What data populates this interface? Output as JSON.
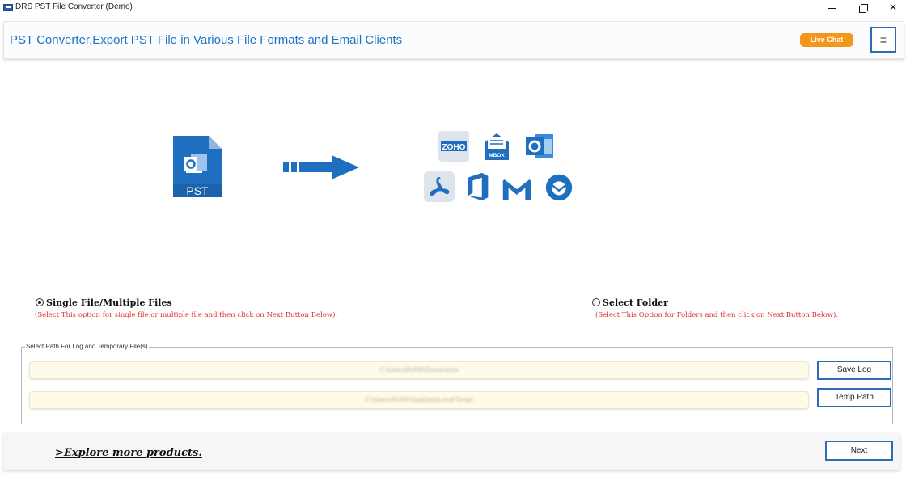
{
  "window": {
    "title": "DRS PST File Converter (Demo)",
    "min_glyph": "",
    "close_glyph": "✕"
  },
  "header": {
    "title": "PST Converter,Export PST File in Various File Formats and Email Clients",
    "live_chat_label": "Live Chat",
    "menu_glyph": "≡"
  },
  "illustration": {
    "source_file_label": "PST",
    "source_icon": "outlook-file-icon",
    "arrow_icon": "right-arrow-icon",
    "target_icons": [
      "zoho-icon",
      "mbox-icon",
      "outlook-icon",
      "pdf-icon",
      "office365-icon",
      "gmail-icon",
      "thunderbird-icon"
    ],
    "mbox_label": "MBOX",
    "zoho_label": "ZOHO"
  },
  "options": {
    "single": {
      "label": "Single File/Multiple Files",
      "hint": "(Select This option for single file or multiple file and then click on Next Button Below).",
      "selected": true
    },
    "folder": {
      "label": "Select Folder",
      "hint": "(Select This Option for Folders and then click on Next Button Below).",
      "selected": false
    }
  },
  "paths": {
    "legend": "Select Path For Log and Temporary File(s)",
    "log_path": "C:\\Users\\RoNR\\Documents",
    "temp_path": "C:\\Users\\RoNR\\AppData\\Local\\Temp\\",
    "save_log_label": "Save Log",
    "temp_path_label": "Temp Path"
  },
  "footer": {
    "explore_label": ">Explore more products.",
    "next_label": "Next"
  },
  "colors": {
    "accent_blue": "#1c74c4",
    "icon_blue": "#1f6fc0",
    "live_chat_orange": "#f4961a",
    "hint_red": "#e0302a",
    "path_field_bg": "#fefbe8"
  }
}
